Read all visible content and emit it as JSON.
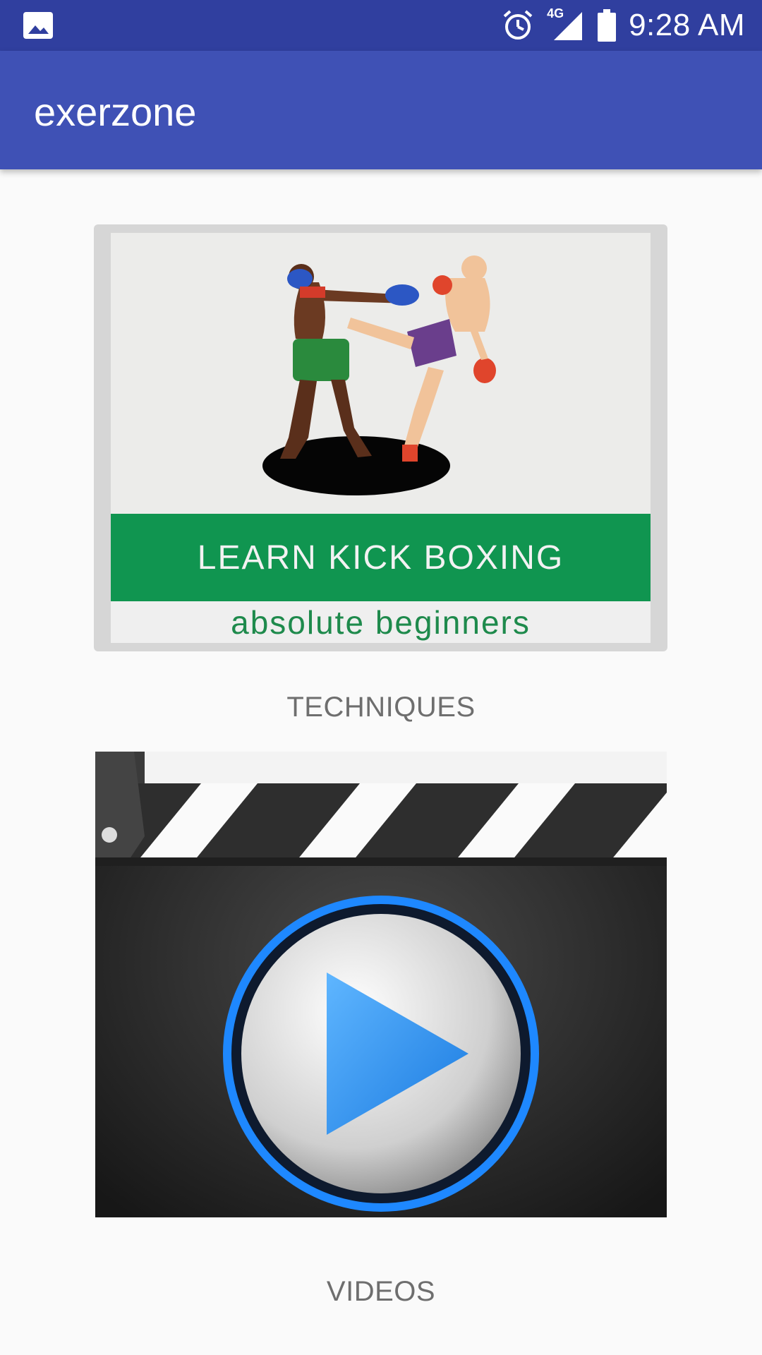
{
  "status_bar": {
    "time": "9:28 AM",
    "network": "4G",
    "icons": [
      "image-notification-icon",
      "alarm-icon",
      "signal-icon",
      "battery-icon"
    ]
  },
  "app_bar": {
    "title": "exerzone"
  },
  "cards": [
    {
      "banner_text": "LEARN KICK BOXING",
      "subtitle": "absolute beginners",
      "label": "TECHNIQUES"
    },
    {
      "label": "VIDEOS"
    }
  ],
  "colors": {
    "status_bar": "#303f9f",
    "app_bar": "#3f51b5",
    "banner_green": "#109550",
    "label_gray": "#6e6e6e"
  }
}
